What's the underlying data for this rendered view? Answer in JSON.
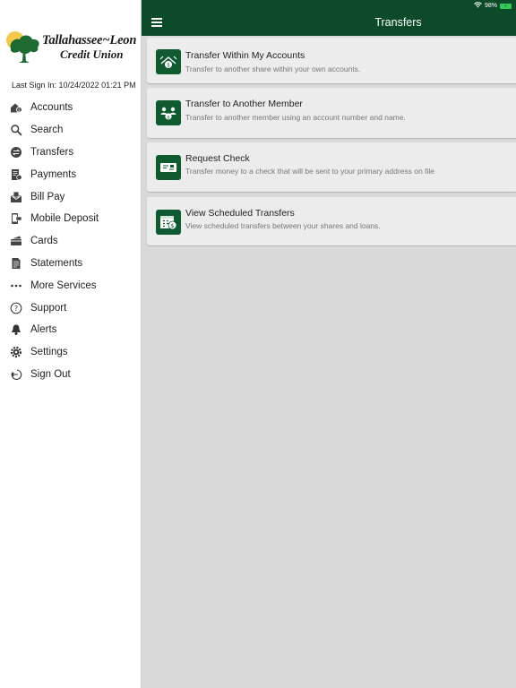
{
  "status_bar": {
    "battery": "98%"
  },
  "header": {
    "title": "Transfers"
  },
  "logo": {
    "line1": "Tallahassee~Leon",
    "line2": "Credit Union"
  },
  "last_sign_in": "Last Sign In: 10/24/2022 01:21 PM",
  "menu": [
    {
      "label": "Accounts",
      "icon": "accounts-icon"
    },
    {
      "label": "Search",
      "icon": "search-icon"
    },
    {
      "label": "Transfers",
      "icon": "transfers-icon"
    },
    {
      "label": "Payments",
      "icon": "payments-icon"
    },
    {
      "label": "Bill Pay",
      "icon": "bill-pay-icon"
    },
    {
      "label": "Mobile Deposit",
      "icon": "mobile-deposit-icon"
    },
    {
      "label": "Cards",
      "icon": "cards-icon"
    },
    {
      "label": "Statements",
      "icon": "statements-icon"
    },
    {
      "label": "More Services",
      "icon": "more-icon"
    },
    {
      "label": "Support",
      "icon": "help-icon"
    },
    {
      "label": "Alerts",
      "icon": "bell-icon"
    },
    {
      "label": "Settings",
      "icon": "gear-icon"
    },
    {
      "label": "Sign Out",
      "icon": "sign-out-icon"
    }
  ],
  "cards": [
    {
      "title": "Transfer Within My Accounts",
      "subtitle": "Transfer to another share within your own accounts.",
      "icon": "transfer-within-icon"
    },
    {
      "title": "Transfer to Another Member",
      "subtitle": "Transfer to another member using an account number and name.",
      "icon": "transfer-member-icon"
    },
    {
      "title": "Request Check",
      "subtitle": "Transfer money to a check that will be sent to your primary address on file",
      "icon": "check-icon"
    },
    {
      "title": "View Scheduled Transfers",
      "subtitle": "View scheduled transfers between your shares and loans.",
      "icon": "calendar-dollar-icon"
    }
  ],
  "colors": {
    "header": "#0d4a2a",
    "accent": "#0f5a31",
    "background": "#d9d9d9"
  }
}
